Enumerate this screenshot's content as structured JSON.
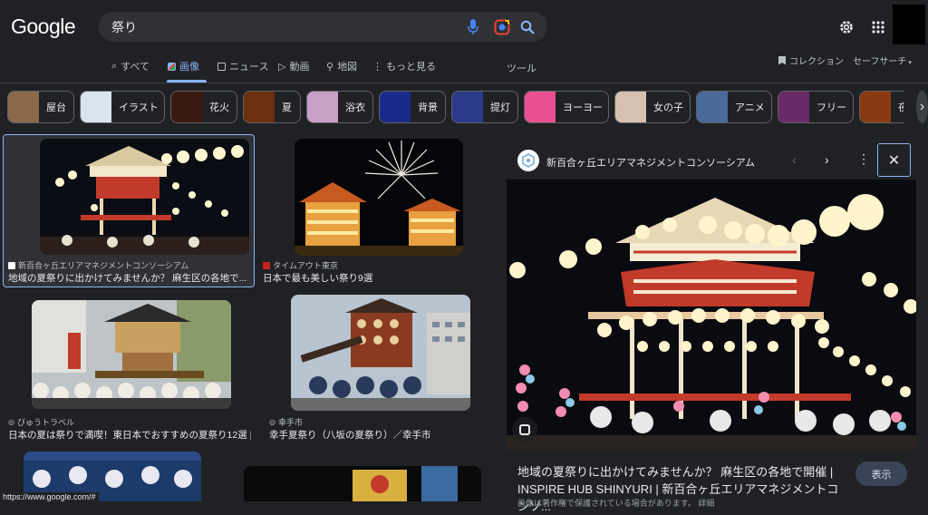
{
  "header": {
    "logo": "Google",
    "query": "祭り",
    "icons": [
      "mic-icon",
      "camera-lens-icon",
      "search-icon",
      "gear-icon",
      "apps-grid-icon"
    ]
  },
  "tabs": [
    {
      "label": "すべて",
      "icon": "search-icon"
    },
    {
      "label": "画像",
      "icon": "image-icon",
      "active": true
    },
    {
      "label": "ニュース",
      "icon": "news-icon"
    },
    {
      "label": "動画",
      "icon": "play-icon"
    },
    {
      "label": "地図",
      "icon": "map-pin-icon"
    },
    {
      "label": "もっと見る",
      "icon": "more-vert-icon"
    }
  ],
  "tools_label": "ツール",
  "collection_label": "コレクション",
  "safesearch_label": "セーフサーチ",
  "chips": [
    {
      "label": "屋台",
      "color": "#8a6a4a"
    },
    {
      "label": "イラスト",
      "color": "#d8e4f0"
    },
    {
      "label": "花火",
      "color": "#3a1a10"
    },
    {
      "label": "夏",
      "color": "#6a3010"
    },
    {
      "label": "浴衣",
      "color": "#c8a0c8"
    },
    {
      "label": "背景",
      "color": "#1a2a8a"
    },
    {
      "label": "提灯",
      "color": "#2a3a8a"
    },
    {
      "label": "ヨーヨー",
      "color": "#e85090"
    },
    {
      "label": "女の子",
      "color": "#d8c0b0"
    },
    {
      "label": "アニメ",
      "color": "#4a6a9a"
    },
    {
      "label": "フリー",
      "color": "#6a2a6a"
    },
    {
      "label": "夜",
      "color": "#8a3a10"
    }
  ],
  "results": [
    {
      "source": "新百合ヶ丘エリアマネジメントコンソーシアム",
      "title": "地域の夏祭りに出かけてみませんか？ 麻生区の各地で..."
    },
    {
      "source": "タイムアウト東京",
      "title": "日本で最も美しい祭り9選"
    },
    {
      "source": "びゅうトラベル",
      "title": "日本の夏は祭りで満喫！東日本でおすすめの夏祭り12選 |..."
    },
    {
      "source": "幸手市",
      "title": "幸手夏祭り（八坂の夏祭り）／幸手市"
    }
  ],
  "panel": {
    "source": "新百合ヶ丘エリアマネジメントコンソーシアム",
    "title_line1": "地域の夏祭りに出かけてみませんか？ 麻生区の各地で開催 |",
    "title_line2": "INSPIRE HUB SHINYURI | 新百合ヶ丘エリアマネジメントコンソ...",
    "subtitle": "画像は著作権で保護されている場合があります。 詳細",
    "visit_label": "表示"
  },
  "status_url": "https://www.google.com/#"
}
